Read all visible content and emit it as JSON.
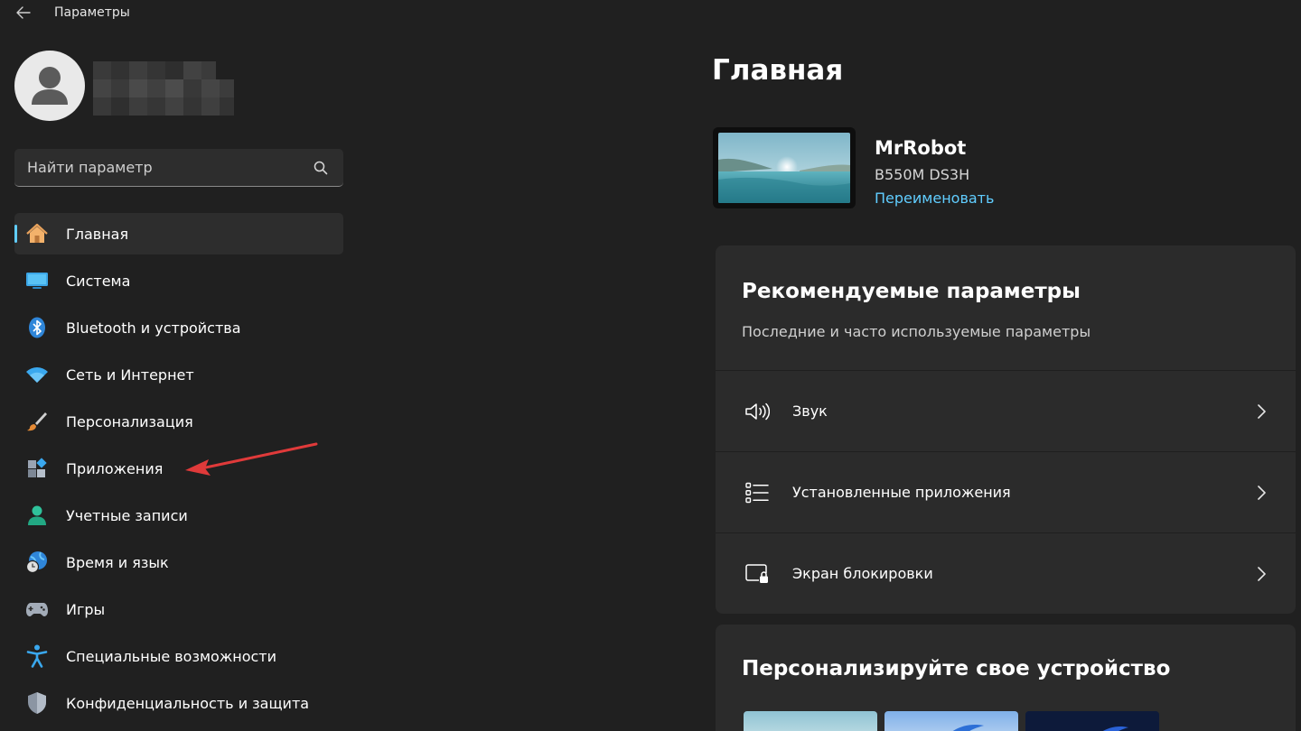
{
  "window": {
    "title": "Параметры",
    "back_icon": "arrow-left-icon"
  },
  "profile": {
    "avatar_icon": "user-avatar-icon"
  },
  "search": {
    "placeholder": "Найти параметр",
    "value": "",
    "icon": "search-icon"
  },
  "sidebar": {
    "items": [
      {
        "label": "Главная",
        "icon": "home-icon",
        "active": true
      },
      {
        "label": "Система",
        "icon": "monitor-icon"
      },
      {
        "label": "Bluetooth и устройства",
        "icon": "bluetooth-icon"
      },
      {
        "label": "Сеть и Интернет",
        "icon": "wifi-icon"
      },
      {
        "label": "Персонализация",
        "icon": "brush-icon"
      },
      {
        "label": "Приложения",
        "icon": "apps-icon"
      },
      {
        "label": "Учетные записи",
        "icon": "account-icon"
      },
      {
        "label": "Время и язык",
        "icon": "globe-clock-icon"
      },
      {
        "label": "Игры",
        "icon": "gamepad-icon"
      },
      {
        "label": "Специальные возможности",
        "icon": "accessibility-icon"
      },
      {
        "label": "Конфиденциальность и защита",
        "icon": "shield-icon"
      }
    ]
  },
  "main": {
    "title": "Главная",
    "device": {
      "name": "MrRobot",
      "model": "B550M DS3H",
      "rename_label": "Переименовать"
    },
    "recommended": {
      "title": "Рекомендуемые параметры",
      "subtitle": "Последние и часто используемые параметры",
      "rows": [
        {
          "label": "Звук",
          "icon": "speaker-icon"
        },
        {
          "label": "Установленные приложения",
          "icon": "app-list-icon"
        },
        {
          "label": "Экран блокировки",
          "icon": "lock-screen-icon"
        }
      ]
    },
    "personalize": {
      "title": "Персонализируйте свое устройство"
    }
  },
  "colors": {
    "background": "#202020",
    "card": "#2b2b2b",
    "accent": "#60cdff",
    "annotation_arrow": "#e03a3a"
  }
}
